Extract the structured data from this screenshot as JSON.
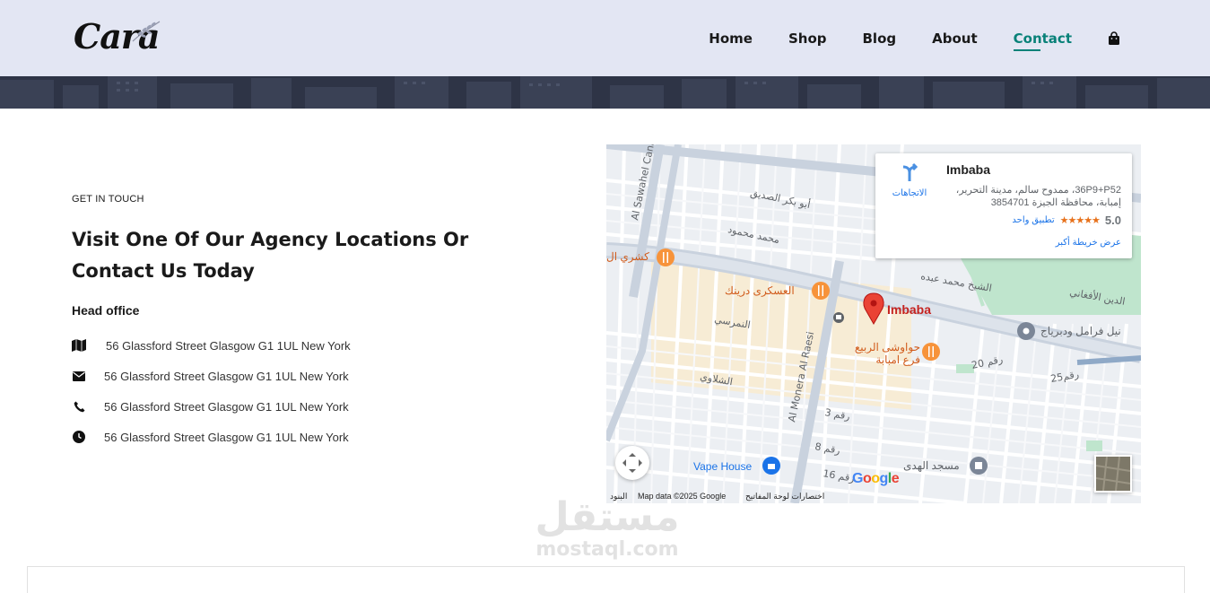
{
  "header": {
    "logo": "Cara",
    "nav": [
      {
        "label": "Home",
        "active": false
      },
      {
        "label": "Shop",
        "active": false
      },
      {
        "label": "Blog",
        "active": false
      },
      {
        "label": "About",
        "active": false
      },
      {
        "label": "Contact",
        "active": true
      }
    ],
    "accent_color": "#088178"
  },
  "contact": {
    "eyebrow": "GET IN TOUCH",
    "headline": "Visit One Of Our Agency Locations Or Contact Us Today",
    "office_heading": "Head office",
    "rows": [
      {
        "icon": "map-icon",
        "text": "56 Glassford Street Glasgow G1 1UL New York"
      },
      {
        "icon": "envelope-icon",
        "text": "56 Glassford Street Glasgow G1 1UL New York"
      },
      {
        "icon": "phone-icon",
        "text": "56 Glassford Street Glasgow G1 1UL New York"
      },
      {
        "icon": "clock-icon",
        "text": "56 Glassford Street Glasgow G1 1UL New York"
      }
    ]
  },
  "map": {
    "card": {
      "title": "Imbaba",
      "address": "36P9+P52، ممدوح سالم، مدينة التحرير، إمبابة، محافظة الجيزة 3854701",
      "rating": "5.0",
      "stars": "★★★★★",
      "reviews": "تطبيق واحد",
      "larger_map": "عرض خريطة أكبر",
      "directions": "الاتجاهات"
    },
    "pin_label": "Imbaba",
    "places": [
      {
        "name": "كشري ال",
        "kind": "restaurant"
      },
      {
        "name": "العسكرى درينك",
        "kind": "restaurant"
      },
      {
        "name": "حواوشى الربيع فرع امبابة",
        "kind": "restaurant"
      },
      {
        "name": "Vape House",
        "kind": "shop"
      },
      {
        "name": "مسجد الهدى",
        "kind": "mosque"
      },
      {
        "name": "نيل فرامل ودبرياج",
        "kind": "place"
      }
    ],
    "streets": [
      "Al Sawahel Canal",
      "Al Monera Al Raesi",
      "أبو بكر الصديق",
      "محمد محمود",
      "الشيخ محمد عبده",
      "رقم 20",
      "رقم 25",
      "رقم 3",
      "رقم 8",
      "رقم 16"
    ],
    "footer": {
      "shortcuts": "اختصارات لوحة المفاتيح",
      "data": "Map data ©2025 Google",
      "terms": "البنود"
    },
    "google": "Google"
  },
  "watermark": {
    "ar": "مستقل",
    "en": "mostaql.com"
  }
}
